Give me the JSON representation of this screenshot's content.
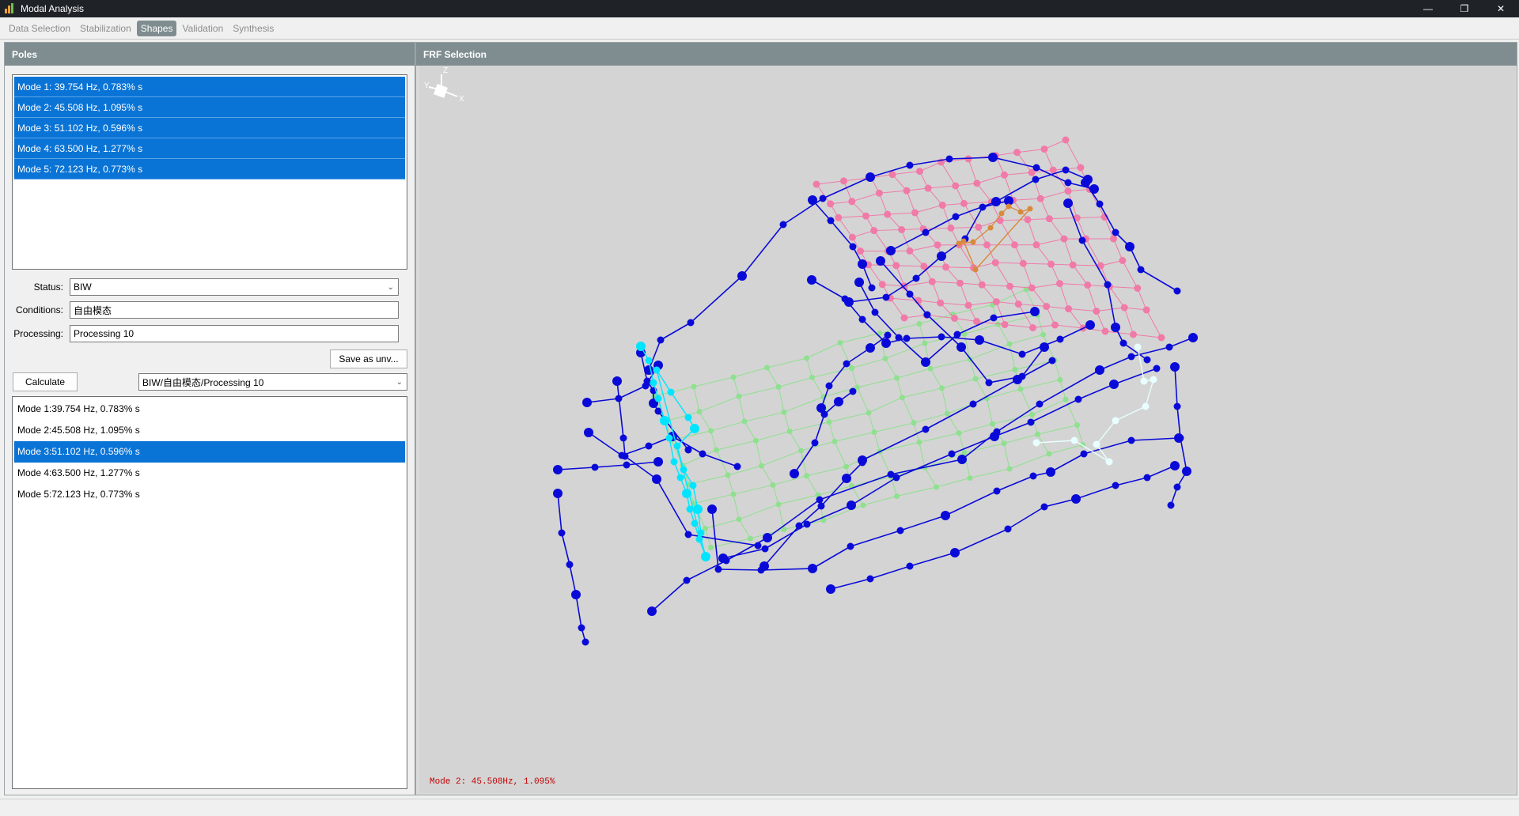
{
  "window": {
    "title": "Modal Analysis",
    "minimize": "—",
    "restore": "❐",
    "close": "✕"
  },
  "tabs": [
    {
      "label": "Data Selection",
      "active": false
    },
    {
      "label": "Stabilization",
      "active": false
    },
    {
      "label": "Shapes",
      "active": true
    },
    {
      "label": "Validation",
      "active": false
    },
    {
      "label": "Synthesis",
      "active": false
    }
  ],
  "poles_panel": {
    "title": "Poles",
    "items": [
      "Mode 1: 39.754 Hz, 0.783% s",
      "Mode 2: 45.508 Hz, 1.095% s",
      "Mode 3: 51.102 Hz, 0.596% s",
      "Mode 4: 63.500 Hz, 1.277% s",
      "Mode 5: 72.123 Hz, 0.773% s"
    ]
  },
  "form": {
    "status_label": "Status:",
    "status_value": "BIW",
    "conditions_label": "Conditions:",
    "conditions_value": "自由模态",
    "processing_label": "Processing:",
    "processing_value": "Processing 10",
    "save_button": "Save as unv...",
    "calculate_button": "Calculate",
    "path_select": "BIW/自由模态/Processing 10"
  },
  "results": {
    "items": [
      "Mode 1:39.754 Hz, 0.783% s",
      "Mode 2:45.508 Hz, 1.095% s",
      "Mode 3:51.102 Hz, 0.596% s",
      "Mode 4:63.500 Hz, 1.277% s",
      "Mode 5:72.123 Hz, 0.773% s"
    ],
    "selected_index": 2
  },
  "frf_panel": {
    "title": "FRF Selection",
    "status_text": "Mode 2: 45.508Hz, 1.095%",
    "axis_labels": {
      "z": "Z",
      "y": "Y",
      "x": "X"
    }
  },
  "colors": {
    "selection": "#0a74d6",
    "panel_header": "#7f8d90",
    "frame_blue": "#0a0ad8",
    "roof_pink": "#f07aa8",
    "floor_green": "#8fe08f",
    "front_cyan": "#00e5ff",
    "rear_white": "#e8ffff",
    "detail_orange": "#d9893a",
    "status_red": "#c00000"
  }
}
